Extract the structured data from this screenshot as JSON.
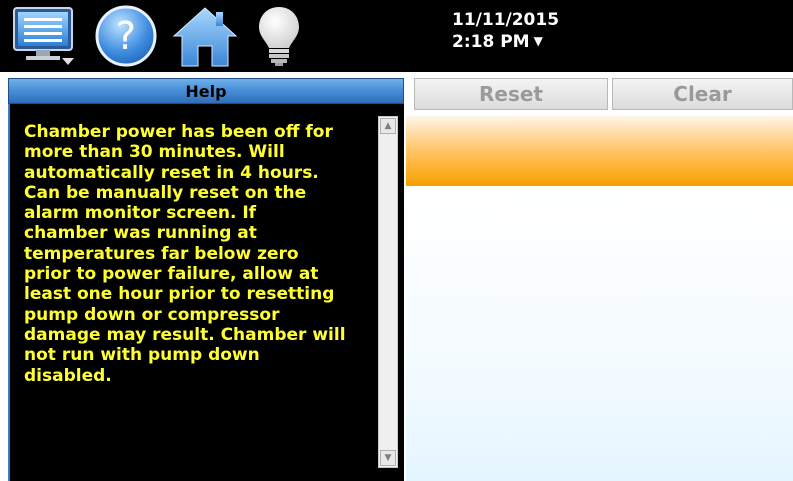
{
  "toolbar": {
    "icons": [
      "monitor-menu-icon",
      "help-icon",
      "home-icon",
      "lightbulb-icon"
    ]
  },
  "datetime": {
    "date": "11/11/2015",
    "time": "2:18 PM",
    "dropdown_glyph": "▼"
  },
  "help": {
    "title": "Help",
    "text": "Chamber power has been off for\nmore than 30 minutes. Will\nautomatically reset in 4 hours.\nCan be manually reset on the\nalarm monitor screen. If\nchamber was running at\ntemperatures far below zero\nprior to power failure, allow at\nleast one hour prior to resetting\npump down or compressor\ndamage may result. Chamber will\nnot run with pump down\ndisabled."
  },
  "alarm_panel": {
    "reset_label": "Reset",
    "clear_label": "Clear"
  },
  "colors": {
    "help_text": "#ffff33",
    "header_blue": "#4a90d9",
    "alarm_orange": "#f5a000",
    "disabled_text": "#9a9a9a"
  }
}
